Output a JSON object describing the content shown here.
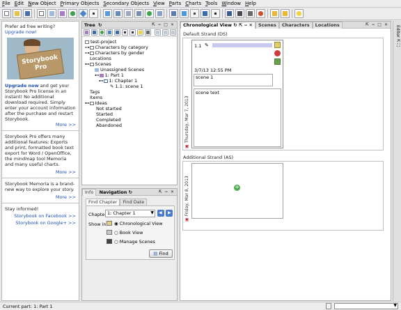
{
  "menu": [
    "File",
    "Edit",
    "New Object",
    "Primary Objects",
    "Secondary Objects",
    "View",
    "Parts",
    "Charts",
    "Tools",
    "Window",
    "Help"
  ],
  "colors": {
    "accent": "#1e4fb8",
    "chrome": "#ececec",
    "panel_header": "#dcdcdc"
  },
  "left": {
    "intro": "Prefer ad free writing?",
    "intro_link": "Upgrade now!",
    "banner_line1": "Storybook",
    "banner_line2": "Pro",
    "upgrade_link": "Upgrade now",
    "upgrade_text": "and get your Storybook Pro license in an instant! No additional download required. Simply enter your account information after the purchase and restart Storybook.",
    "more1": "More >>",
    "pro_text": "Storybook Pro offers many additional features: Exports and print, formatted book text export for Word / OpenOffice, the mindmap tool Memoria and many useful charts.",
    "more2": "More >>",
    "memoria_text": "Storybook Memoria is a brand-new way to explore your story.",
    "more3": "More >>",
    "stay": "Stay informed!",
    "facebook": "Storybook on Facebook >>",
    "google": "Storybook on Google+ >>"
  },
  "tree": {
    "title": "Tree",
    "items": [
      "test-project",
      "Characters by category",
      "Characters by gender",
      "Locations",
      "Scenes",
      "Unassigned Scenes",
      "1: Part 1",
      "1: Chapter 1",
      "1.1: scene 1",
      "Tags",
      "Items",
      "Ideas",
      "Not started",
      "Started",
      "Completed",
      "Abandoned"
    ]
  },
  "navigation": {
    "tab_info": "Info",
    "title": "Navigation",
    "tab_find_chapter": "Find Chapter",
    "tab_find_date": "Find Date",
    "chapter_label": "Chapter",
    "chapter_value": "1: Chapter 1",
    "show_in": "Show in:",
    "opt1": "Chronological View",
    "opt2": "Book View",
    "opt3": "Manage Scenes",
    "find_button": "Find"
  },
  "chrono": {
    "title": "Chronological View",
    "tab_scenes": "Scenes",
    "tab_characters": "Characters",
    "tab_locations": "Locations",
    "strand1": "Default Strand (DS)",
    "date1": "Thursday, Mar 7, 2013",
    "scene_number": "1.1",
    "scene_time": "3/7/13 12:55 PM",
    "scene_title": "scene 1",
    "scene_text": "scene text",
    "strand2": "Additional Strand (AS)",
    "date2": "Friday, Mar 8, 2013"
  },
  "right_strip": {
    "label": "Editor"
  },
  "status": {
    "text": "Current part: 1: Part 1"
  }
}
